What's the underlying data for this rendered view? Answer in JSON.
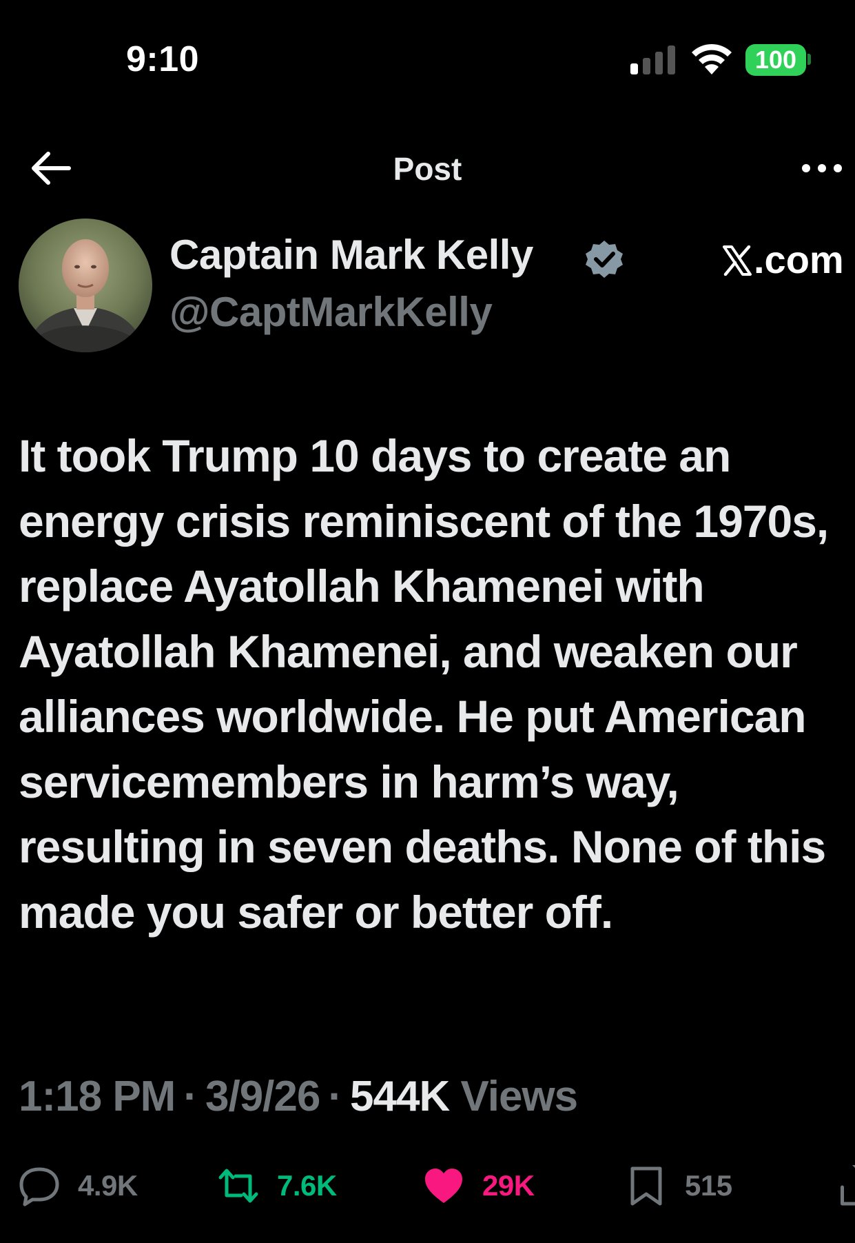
{
  "status_bar": {
    "time": "9:10",
    "battery": "100",
    "battery_color": "#30d158"
  },
  "nav": {
    "title": "Post",
    "back_icon": "arrow-left-icon",
    "more_icon": "more-horizontal-icon"
  },
  "author": {
    "name": "Captain Mark Kelly",
    "handle": "@CaptMarkKelly",
    "verified_icon": "verified-badge-icon",
    "verified_color": "#8899a6"
  },
  "watermark": {
    "label": ".com",
    "icon": "x-logo-icon"
  },
  "post": {
    "text": "It took Trump 10 days to create an energy crisis reminiscent of the 1970s, replace Ayatollah Khamenei with Ayatollah Khamenei, and weaken our alliances worldwide. He put American servicemembers in harm’s way, resulting in seven deaths. None of this made you safer or better off."
  },
  "meta": {
    "time": "1:18 PM",
    "separator": "·",
    "date": "3/9/26",
    "views_count": "544K",
    "views_label": "Views"
  },
  "actions": {
    "replies": "4.9K",
    "reposts": "7.6K",
    "likes": "29K",
    "bookmarks": "515",
    "reply_color": "#71767b",
    "repost_color": "#00ba7c",
    "like_color": "#f91880",
    "bookmark_color": "#71767b"
  }
}
